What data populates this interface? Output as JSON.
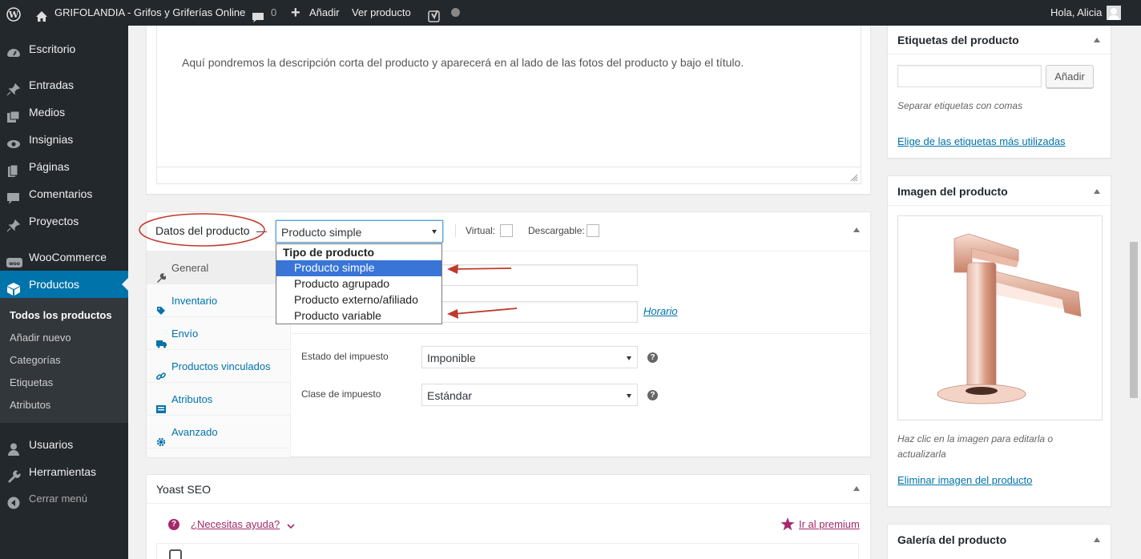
{
  "adminbar": {
    "site_name": "GRIFOLANDIA - Grifos y Griferías Online",
    "comments_count": "0",
    "add_new": "Añadir",
    "view_product": "Ver producto",
    "greeting": "Hola, Alicia"
  },
  "sidebar": {
    "items": [
      {
        "label": "Escritorio",
        "icon": "dashboard-icon"
      },
      {
        "label": "Entradas",
        "icon": "pin-icon"
      },
      {
        "label": "Medios",
        "icon": "media-icon"
      },
      {
        "label": "Insignias",
        "icon": "eye-icon"
      },
      {
        "label": "Páginas",
        "icon": "page-icon"
      },
      {
        "label": "Comentarios",
        "icon": "comment-icon"
      },
      {
        "label": "Proyectos",
        "icon": "pin-icon"
      },
      {
        "label": "WooCommerce",
        "icon": "woo-icon"
      },
      {
        "label": "Productos",
        "icon": "box-icon"
      },
      {
        "label": "Usuarios",
        "icon": "user-icon"
      },
      {
        "label": "Herramientas",
        "icon": "wrench-icon"
      },
      {
        "label": "Cerrar menú",
        "icon": "collapse-icon"
      }
    ],
    "submenu": [
      "Todos los productos",
      "Añadir nuevo",
      "Categorías",
      "Etiquetas",
      "Atributos"
    ]
  },
  "short_description": {
    "text": "Aquí pondremos la descripción corta del producto y aparecerá en al lado de las fotos del producto y bajo el título."
  },
  "product_data": {
    "title": "Datos del producto",
    "type_selected": "Producto simple",
    "virtual_label": "Virtual:",
    "downloadable_label": "Descargable:",
    "dropdown": {
      "group_label": "Tipo de producto",
      "options": [
        "Producto simple",
        "Producto agrupado",
        "Producto externo/afiliado",
        "Producto variable"
      ]
    },
    "tabs": [
      {
        "label": "General",
        "icon": "wrench-icon"
      },
      {
        "label": "Inventario",
        "icon": "tag-icon"
      },
      {
        "label": "Envío",
        "icon": "truck-icon"
      },
      {
        "label": "Productos vinculados",
        "icon": "link-icon"
      },
      {
        "label": "Atributos",
        "icon": "list-icon"
      },
      {
        "label": "Avanzado",
        "icon": "gear-icon"
      }
    ],
    "schedule_link": "Horario",
    "tax_status_label": "Estado del impuesto",
    "tax_status_value": "Imponible",
    "tax_class_label": "Clase de impuesto",
    "tax_class_value": "Estándar"
  },
  "yoast": {
    "title": "Yoast SEO",
    "help_link": "¿Necesitas ayuda?",
    "premium_link": "Ir al premium"
  },
  "tags_panel": {
    "title": "Etiquetas del producto",
    "add_button": "Añadir",
    "hint": "Separar etiquetas con comas",
    "popular_link": "Elige de las etiquetas más utilizadas"
  },
  "image_panel": {
    "title": "Imagen del producto",
    "hint": "Haz clic en la imagen para editarla o actualizarla",
    "remove_link": "Eliminar imagen del producto"
  },
  "gallery_panel": {
    "title": "Galería del producto"
  },
  "colors": {
    "admin_bg": "#23282d",
    "accent": "#0073aa",
    "highlight": "#3875d7",
    "annotation": "#c0392b"
  }
}
